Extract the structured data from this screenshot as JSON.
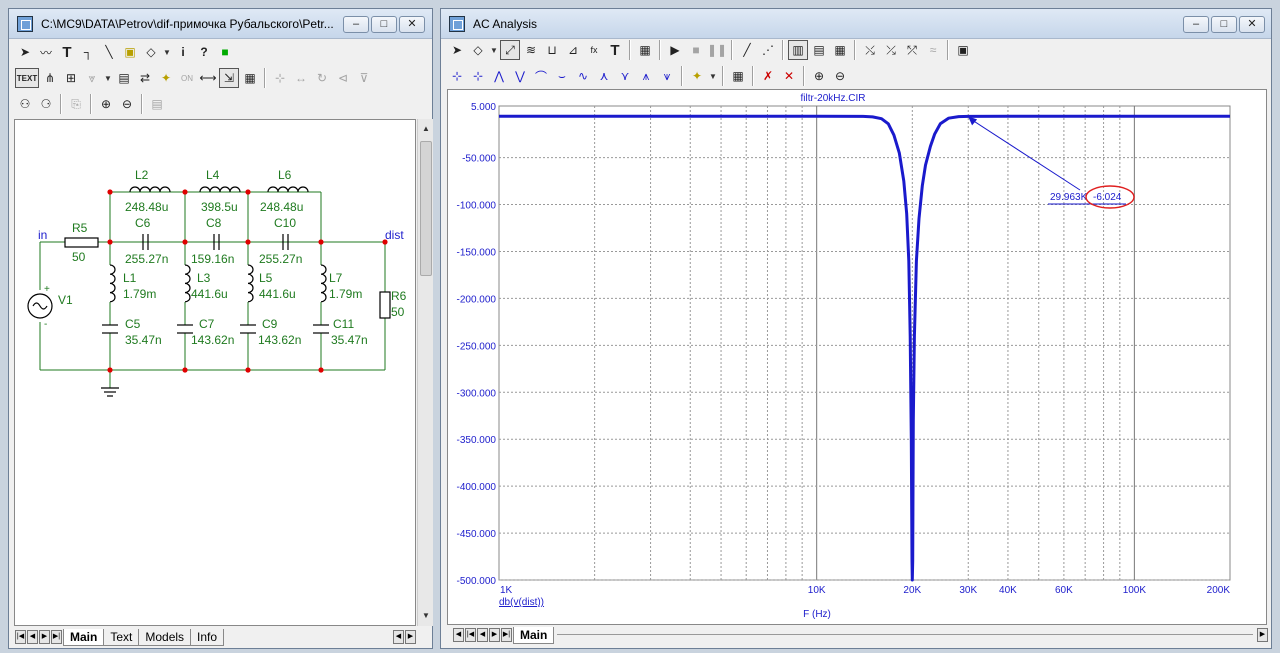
{
  "left_window": {
    "title": "C:\\MC9\\DATA\\Petrov\\dif-примочка Рубальского\\Petr...",
    "toolbar1": [
      "select-arrow-icon",
      "wire-icon",
      "text-tool-icon",
      "ortho-wire-icon",
      "line-icon",
      "component-icon",
      "flag-icon",
      "info-icon",
      "help-icon",
      "color-icon"
    ],
    "toolbar2_text_label": "TEXT",
    "tabs": [
      {
        "label": "Main",
        "active": true
      },
      {
        "label": "Text",
        "active": false
      },
      {
        "label": "Models",
        "active": false
      },
      {
        "label": "Info",
        "active": false
      }
    ]
  },
  "schematic": {
    "components": [
      {
        "name": "L2",
        "value": "248.48u"
      },
      {
        "name": "L4",
        "value": "398.5u"
      },
      {
        "name": "L6",
        "value": "248.48u"
      },
      {
        "name": "C6",
        "value": "255.27n"
      },
      {
        "name": "C8",
        "value": "159.16n"
      },
      {
        "name": "C10",
        "value": "255.27n"
      },
      {
        "name": "R5",
        "value": "50"
      },
      {
        "name": "L1",
        "value": "1.79m"
      },
      {
        "name": "L3",
        "value": "441.6u"
      },
      {
        "name": "L5",
        "value": "441.6u"
      },
      {
        "name": "L7",
        "value": "1.79m"
      },
      {
        "name": "C5",
        "value": "35.47n"
      },
      {
        "name": "C7",
        "value": "143.62n"
      },
      {
        "name": "C9",
        "value": "143.62n"
      },
      {
        "name": "C11",
        "value": "35.47n"
      },
      {
        "name": "R6",
        "value": "50"
      },
      {
        "name": "V1",
        "value": ""
      }
    ],
    "node_in": "in",
    "node_dist": "dist",
    "plus": "+",
    "minus": "-"
  },
  "right_window": {
    "title": "AC Analysis",
    "tabs": [
      {
        "label": "Main",
        "active": true
      }
    ]
  },
  "chart_data": {
    "type": "line",
    "title": "filtr-20kHz.CIR",
    "xlabel": "F (Hz)",
    "trace_label": "db(v(dist))",
    "x_scale": "log",
    "xlim": [
      1000,
      200000
    ],
    "ylim": [
      -500,
      5
    ],
    "x_ticks": [
      {
        "value": 1000,
        "label": "1K"
      },
      {
        "value": 10000,
        "label": "10K"
      },
      {
        "value": 20000,
        "label": "20K"
      },
      {
        "value": 30000,
        "label": "30K"
      },
      {
        "value": 40000,
        "label": "40K"
      },
      {
        "value": 60000,
        "label": "60K"
      },
      {
        "value": 100000,
        "label": "100K"
      },
      {
        "value": 200000,
        "label": "200K"
      }
    ],
    "y_ticks": [
      {
        "value": 5,
        "label": "5.000"
      },
      {
        "value": -50,
        "label": "-50.000"
      },
      {
        "value": -100,
        "label": "-100.000"
      },
      {
        "value": -150,
        "label": "-150.000"
      },
      {
        "value": -200,
        "label": "-200.000"
      },
      {
        "value": -250,
        "label": "-250.000"
      },
      {
        "value": -300,
        "label": "-300.000"
      },
      {
        "value": -350,
        "label": "-350.000"
      },
      {
        "value": -400,
        "label": "-400.000"
      },
      {
        "value": -450,
        "label": "-450.000"
      },
      {
        "value": -500,
        "label": "-500.000"
      }
    ],
    "grid": true,
    "color": "#1a1acc",
    "series": [
      {
        "x": [
          1000,
          5000,
          10000,
          14000,
          15000,
          16000,
          16800,
          17500,
          18200,
          18800,
          19200,
          19500,
          19700,
          19850,
          19950,
          20000,
          20050,
          20150,
          20300,
          20600,
          21000,
          21500,
          22000,
          22800,
          23500,
          24500,
          26000,
          28000,
          30000,
          40000,
          60000,
          100000,
          200000
        ],
        "y": [
          -6.02,
          -6.02,
          -6.02,
          -6.1,
          -6.6,
          -8.5,
          -14,
          -26,
          -45,
          -75,
          -110,
          -160,
          -240,
          -350,
          -480,
          -500,
          -480,
          -330,
          -240,
          -160,
          -115,
          -80,
          -58,
          -38,
          -25,
          -14,
          -8,
          -6.3,
          -6.03,
          -6.02,
          -6.02,
          -6.02,
          -6.02
        ]
      }
    ],
    "cursor": {
      "x_label": "29.963K",
      "y_label": "-6.024",
      "x": 29963,
      "y": -6.024
    }
  }
}
